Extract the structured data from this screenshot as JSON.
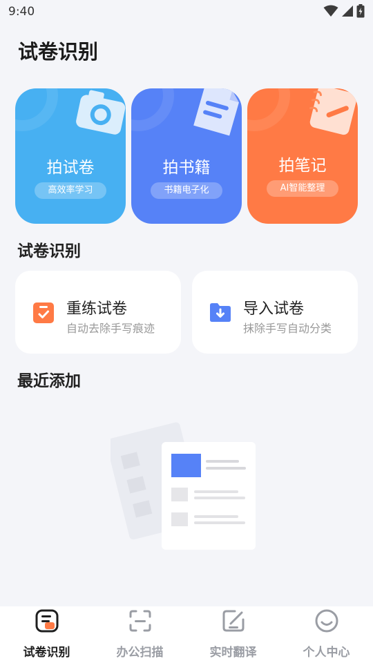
{
  "status_bar": {
    "time": "9:40"
  },
  "page": {
    "title": "试卷识别"
  },
  "feature_cards": [
    {
      "title": "拍试卷",
      "tag": "高效率学习",
      "color": "#47b0f2",
      "icon": "camera-icon"
    },
    {
      "title": "拍书籍",
      "tag": "书籍电子化",
      "color": "#5682f7",
      "icon": "document-icon"
    },
    {
      "title": "拍笔记",
      "tag": "AI智能整理",
      "color": "#ff7a45",
      "icon": "notebook-icon"
    }
  ],
  "sections": {
    "exam": "试卷识别",
    "recent": "最近添加"
  },
  "actions": [
    {
      "title": "重练试卷",
      "subtitle": "自动去除手写痕迹",
      "icon": "checklist-icon",
      "color": "#ff7a45"
    },
    {
      "title": "导入试卷",
      "subtitle": "抹除手写自动分类",
      "icon": "folder-import-icon",
      "color": "#5682f7"
    }
  ],
  "tabs": [
    {
      "label": "试卷识别",
      "icon": "exam-icon",
      "active": true
    },
    {
      "label": "办公扫描",
      "icon": "scan-icon",
      "active": false
    },
    {
      "label": "实时翻译",
      "icon": "edit-square-icon",
      "active": false
    },
    {
      "label": "个人中心",
      "icon": "smile-icon",
      "active": false
    }
  ],
  "colors": {
    "accent": "#5682f7",
    "orange": "#ff7a45",
    "sky": "#47b0f2",
    "background": "#f4f5f9"
  }
}
